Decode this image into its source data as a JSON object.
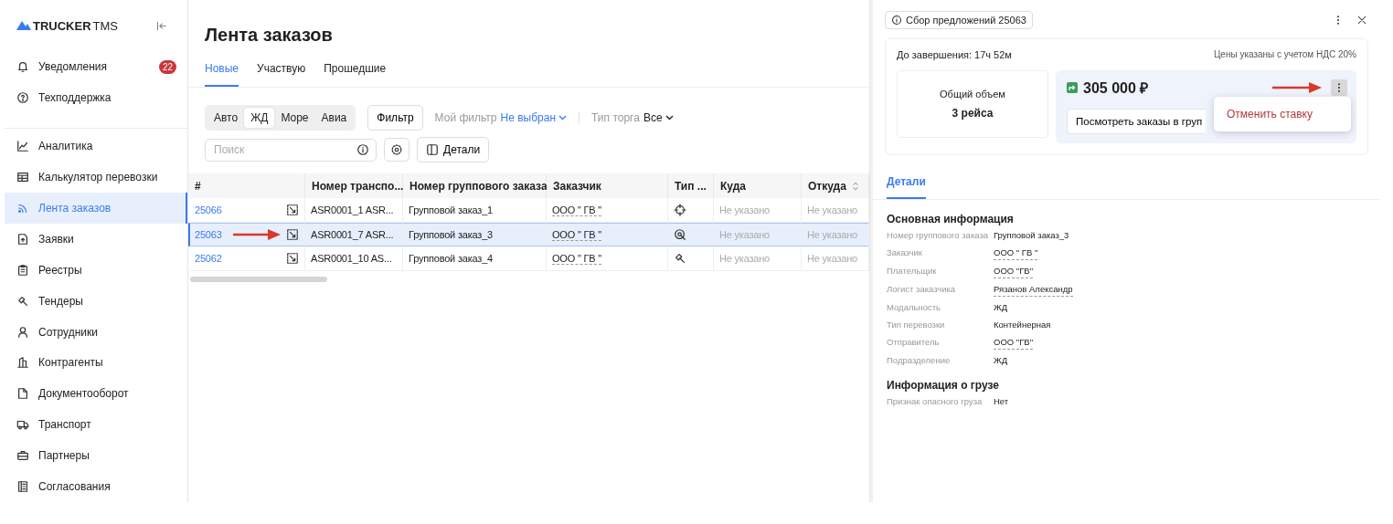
{
  "sidebar": {
    "logo": {
      "brand": "TRUCKER",
      "suffix": "TMS"
    },
    "top_items": [
      {
        "label": "Уведомления",
        "kind": "bell",
        "badge": "22",
        "selected": false
      },
      {
        "label": "Техподдержка",
        "kind": "help",
        "selected": false
      }
    ],
    "items": [
      {
        "label": "Аналитика",
        "kind": "chart",
        "selected": false
      },
      {
        "label": "Калькулятор перевозки",
        "kind": "table",
        "selected": false
      },
      {
        "label": "Лента заказов",
        "kind": "feed",
        "selected": true
      },
      {
        "label": "Заявки",
        "kind": "doc",
        "selected": false
      },
      {
        "label": "Реестры",
        "kind": "clipboard",
        "selected": false
      },
      {
        "label": "Тендеры",
        "kind": "gavel",
        "selected": false
      },
      {
        "label": "Сотрудники",
        "kind": "person",
        "selected": false
      },
      {
        "label": "Контрагенты",
        "kind": "building",
        "selected": false
      },
      {
        "label": "Документооборот",
        "kind": "file",
        "selected": false
      },
      {
        "label": "Транспорт",
        "kind": "truck",
        "selected": false
      },
      {
        "label": "Партнеры",
        "kind": "case",
        "selected": false
      },
      {
        "label": "Согласования",
        "kind": "book",
        "selected": false
      }
    ]
  },
  "page": {
    "title": "Лента заказов",
    "tabs": [
      {
        "label": "Новые",
        "selected": true
      },
      {
        "label": "Участвую",
        "selected": false
      },
      {
        "label": "Прошедшие",
        "selected": false
      }
    ],
    "modes": [
      {
        "label": "Авто",
        "selected": false
      },
      {
        "label": "ЖД",
        "selected": true
      },
      {
        "label": "Море",
        "selected": false
      },
      {
        "label": "Авиа",
        "selected": false
      }
    ],
    "filter_button": "Фильтр",
    "my_filter": {
      "label": "Мой фильтр",
      "value": "Не выбран"
    },
    "trade_type": {
      "label": "Тип торга",
      "value": "Все"
    },
    "search": {
      "placeholder": "Поиск"
    },
    "details_button": "Детали",
    "table": {
      "columns": [
        "#",
        "Номер транспо...",
        "Номер группового заказа",
        "Заказчик",
        "Тип ...",
        "Куда",
        "Откуда"
      ],
      "rows": [
        {
          "id": "25066",
          "transport": "ASR0001_1 ASR...",
          "group": "Групповой заказ_1",
          "customer": "ООО \" ГВ \"",
          "kind": "target",
          "to": "Не указано",
          "from": "Не указано",
          "selected": false,
          "marked": false
        },
        {
          "id": "25063",
          "transport": "ASR0001_7 ASR...",
          "group": "Групповой заказ_3",
          "customer": "ООО \" ГВ \"",
          "kind": "search",
          "to": "Не указано",
          "from": "Не указано",
          "selected": true,
          "marked": true
        },
        {
          "id": "25062",
          "transport": "ASR0001_10 AS...",
          "group": "Групповой заказ_4",
          "customer": "ООО \" ГВ \"",
          "kind": "gavel",
          "to": "Не указано",
          "from": "Не указано",
          "selected": false,
          "marked": false
        }
      ]
    }
  },
  "panel": {
    "chip": "Сбор предложений 25063",
    "countdown": "До завершения: 17ч 52м",
    "vat_note": "Цены указаны с учетом НДС 20%",
    "volume": {
      "label": "Общий объем",
      "value": "3 рейса"
    },
    "bid": {
      "price": "305 000 ₽",
      "button": "Посмотреть заказы в груп",
      "menu_marked": true,
      "menu": [
        "Отменить ставку"
      ]
    },
    "tabs": [
      {
        "label": "Детали",
        "selected": true
      }
    ],
    "sections": [
      {
        "title": "Основная информация",
        "fields": [
          {
            "label": "Номер группового заказа",
            "value": "Групповой заказ_3",
            "underlined": false
          },
          {
            "label": "Заказчик",
            "value": "ООО \" ГВ \"",
            "underlined": true
          },
          {
            "label": "Плательщик",
            "value": "ООО \"ГВ\"",
            "underlined": true
          },
          {
            "label": "Логист заказчика",
            "value": "Рязанов Александр",
            "underlined": true
          },
          {
            "label": "Модальность",
            "value": "ЖД",
            "underlined": false
          },
          {
            "label": "Тип перевозки",
            "value": "Контейнерная",
            "underlined": false
          },
          {
            "label": "Отправитель",
            "value": "ООО \"ГВ\"",
            "underlined": true
          },
          {
            "label": "Подразделение",
            "value": "ЖД",
            "underlined": false
          }
        ]
      },
      {
        "title": "Информация о грузе",
        "fields": [
          {
            "label": "Признак опасного груза",
            "value": "Нет",
            "underlined": false
          }
        ]
      }
    ]
  }
}
